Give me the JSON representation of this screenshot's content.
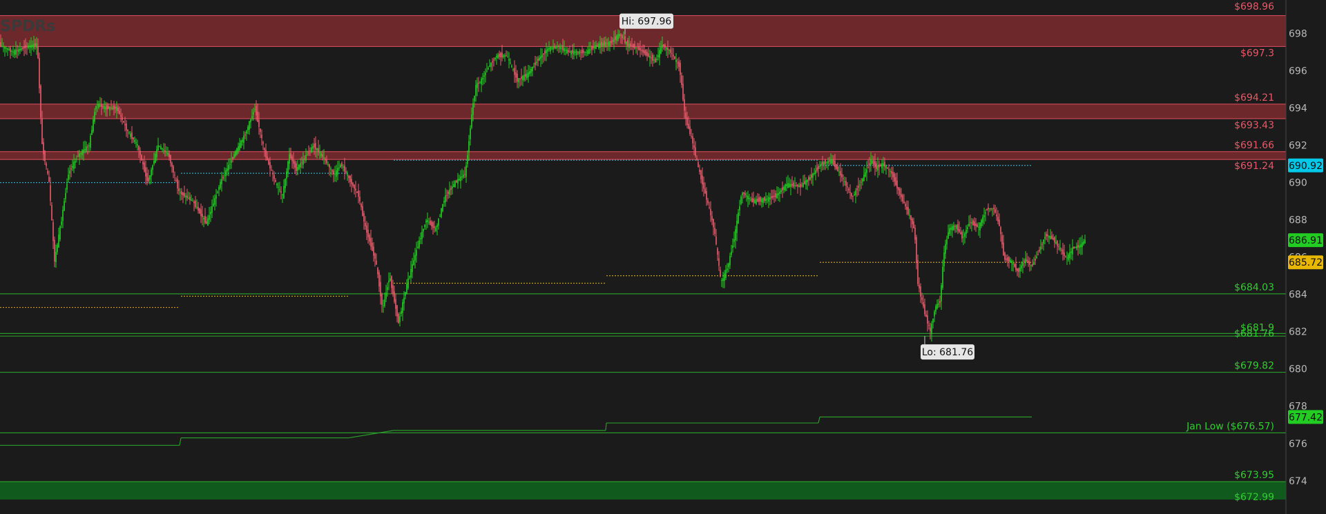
{
  "watermark": "SPDRs",
  "chart_data": {
    "type": "candlestick",
    "ylim": [
      672.4,
      699.5
    ],
    "y_ticks": [
      "698",
      "696",
      "694",
      "692",
      "690",
      "688",
      "686",
      "684",
      "682",
      "680",
      "678",
      "676",
      "674"
    ],
    "high_label": "Hi: 697.96",
    "low_label": "Lo: 681.76",
    "high": 697.96,
    "low": 681.76,
    "last_price": 686.91,
    "resistance_zones": [
      {
        "from": 697.3,
        "to": 698.96,
        "labels": [
          "$698.96",
          "$697.3"
        ]
      },
      {
        "from": 693.43,
        "to": 694.21,
        "labels": [
          "$694.21",
          "$693.43"
        ]
      },
      {
        "from": 691.24,
        "to": 691.66,
        "labels": [
          "$691.66",
          "$691.24"
        ]
      }
    ],
    "support_levels": [
      {
        "value": 684.03,
        "label": "$684.03"
      },
      {
        "value": 681.9,
        "label": "$681.9"
      },
      {
        "value": 681.76,
        "label": "$681.76"
      },
      {
        "value": 679.82,
        "label": "$679.82"
      },
      {
        "value": 676.57,
        "label": "Jan Low ($676.57)"
      },
      {
        "value": 673.95,
        "label": "$673.95"
      }
    ],
    "support_zone": {
      "from": 672.99,
      "to": 673.95,
      "label": "$672.99"
    },
    "price_tags": [
      {
        "value": 690.92,
        "label": "690.92",
        "color": "#00c8e8"
      },
      {
        "value": 686.91,
        "label": "686.91",
        "color": "#22cc22"
      },
      {
        "value": 685.72,
        "label": "685.72",
        "color": "#e8b800"
      },
      {
        "value": 677.42,
        "label": "677.42",
        "color": "#22cc22"
      }
    ],
    "session_levels": {
      "cyan": [
        {
          "session": 1,
          "value": 690.0
        },
        {
          "session": 2,
          "value": 690.5
        },
        {
          "session": 3,
          "value": 691.2
        },
        {
          "session": 4,
          "value": 691.2
        },
        {
          "session": 5,
          "value": 690.92
        }
      ],
      "gold": [
        {
          "session": 1,
          "value": 683.3
        },
        {
          "session": 2,
          "value": 683.9
        },
        {
          "session": 3,
          "value": 684.6
        },
        {
          "session": 4,
          "value": 685.0
        },
        {
          "session": 5,
          "value": 685.72
        }
      ],
      "green_step": [
        {
          "session": 1,
          "value": 675.9
        },
        {
          "session": 2,
          "value": 676.3
        },
        {
          "session": 3,
          "value": 676.7
        },
        {
          "session": 4,
          "value": 677.1
        },
        {
          "session": 5,
          "value": 677.42
        }
      ]
    },
    "price_path": [
      [
        0,
        697.4
      ],
      [
        20,
        697.0
      ],
      [
        40,
        697.3
      ],
      [
        55,
        697.4
      ],
      [
        62,
        692.0
      ],
      [
        72,
        690.0
      ],
      [
        80,
        685.8
      ],
      [
        90,
        688.0
      ],
      [
        100,
        690.5
      ],
      [
        115,
        691.5
      ],
      [
        130,
        692.0
      ],
      [
        140,
        694.2
      ],
      [
        155,
        694.0
      ],
      [
        170,
        694.0
      ],
      [
        185,
        692.8
      ],
      [
        200,
        692.0
      ],
      [
        215,
        690.0
      ],
      [
        230,
        692.0
      ],
      [
        245,
        691.5
      ],
      [
        260,
        689.5
      ],
      [
        280,
        689.0
      ],
      [
        300,
        687.8
      ],
      [
        320,
        690.0
      ],
      [
        340,
        691.5
      ],
      [
        355,
        692.5
      ],
      [
        370,
        694.0
      ],
      [
        385,
        691.5
      ],
      [
        400,
        690.0
      ],
      [
        410,
        689.3
      ],
      [
        420,
        691.5
      ],
      [
        430,
        690.7
      ],
      [
        440,
        691.2
      ],
      [
        455,
        692.0
      ],
      [
        470,
        691.3
      ],
      [
        485,
        690.4
      ],
      [
        495,
        691.0
      ],
      [
        505,
        690.3
      ],
      [
        520,
        689.3
      ],
      [
        530,
        687.6
      ],
      [
        545,
        685.8
      ],
      [
        555,
        683.2
      ],
      [
        565,
        685.0
      ],
      [
        578,
        682.5
      ],
      [
        590,
        684.5
      ],
      [
        605,
        686.5
      ],
      [
        618,
        688.0
      ],
      [
        632,
        687.5
      ],
      [
        645,
        689.2
      ],
      [
        660,
        690.0
      ],
      [
        675,
        690.5
      ],
      [
        685,
        694.0
      ],
      [
        690,
        695.2
      ],
      [
        698,
        695.5
      ],
      [
        710,
        696.3
      ],
      [
        720,
        696.8
      ],
      [
        735,
        696.8
      ],
      [
        750,
        695.5
      ],
      [
        765,
        695.8
      ],
      [
        780,
        696.6
      ],
      [
        795,
        697.2
      ],
      [
        810,
        697.3
      ],
      [
        825,
        697.0
      ],
      [
        838,
        697.0
      ],
      [
        850,
        697.0
      ],
      [
        862,
        697.3
      ],
      [
        870,
        697.4
      ],
      [
        885,
        697.5
      ],
      [
        898,
        697.96
      ],
      [
        910,
        697.4
      ],
      [
        925,
        697.2
      ],
      [
        940,
        696.8
      ],
      [
        950,
        696.5
      ],
      [
        960,
        697.4
      ],
      [
        972,
        697.0
      ],
      [
        985,
        696.2
      ],
      [
        993,
        693.5
      ],
      [
        1003,
        692.3
      ],
      [
        1012,
        690.8
      ],
      [
        1025,
        689.0
      ],
      [
        1035,
        687.5
      ],
      [
        1045,
        684.6
      ],
      [
        1055,
        685.5
      ],
      [
        1065,
        687.2
      ],
      [
        1075,
        689.5
      ],
      [
        1090,
        689.0
      ],
      [
        1110,
        689.1
      ],
      [
        1125,
        689.3
      ],
      [
        1140,
        689.9
      ],
      [
        1160,
        689.8
      ],
      [
        1175,
        690.3
      ],
      [
        1190,
        691.0
      ],
      [
        1205,
        691.2
      ],
      [
        1220,
        690.3
      ],
      [
        1235,
        689.2
      ],
      [
        1250,
        690.2
      ],
      [
        1262,
        691.2
      ],
      [
        1270,
        690.8
      ],
      [
        1280,
        691.0
      ],
      [
        1292,
        690.5
      ],
      [
        1305,
        689.3
      ],
      [
        1318,
        688.2
      ],
      [
        1325,
        687.5
      ],
      [
        1330,
        684.6
      ],
      [
        1340,
        683.0
      ],
      [
        1348,
        682.0
      ],
      [
        1355,
        683.3
      ],
      [
        1362,
        683.6
      ],
      [
        1368,
        686.3
      ],
      [
        1375,
        687.5
      ],
      [
        1385,
        687.7
      ],
      [
        1395,
        687.0
      ],
      [
        1405,
        687.9
      ],
      [
        1418,
        687.6
      ],
      [
        1430,
        688.6
      ],
      [
        1440,
        688.6
      ],
      [
        1448,
        687.7
      ],
      [
        1455,
        685.9
      ],
      [
        1465,
        685.8
      ],
      [
        1475,
        685.2
      ],
      [
        1485,
        685.9
      ],
      [
        1495,
        685.5
      ],
      [
        1505,
        686.3
      ],
      [
        1515,
        687.2
      ],
      [
        1525,
        687.0
      ],
      [
        1535,
        686.5
      ],
      [
        1545,
        685.9
      ],
      [
        1555,
        686.5
      ],
      [
        1565,
        686.6
      ],
      [
        1572,
        686.91
      ]
    ],
    "grid": false,
    "legend": "none"
  }
}
